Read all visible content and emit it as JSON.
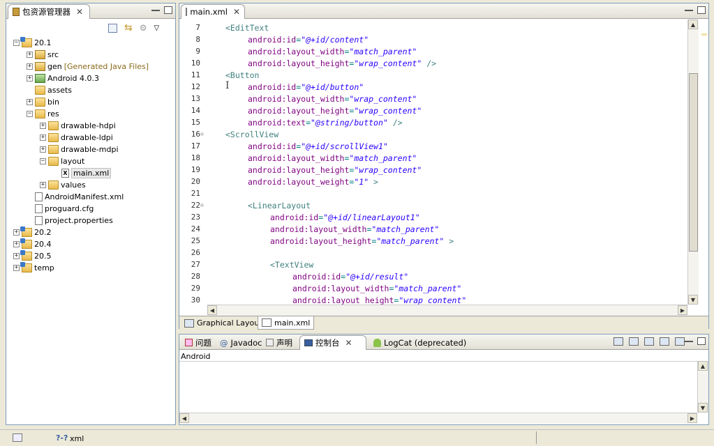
{
  "explorer": {
    "title": "包资源管理器",
    "tree": [
      {
        "label": "20.1",
        "icon": "project-icon",
        "depth": 0,
        "twisty": "−"
      },
      {
        "label": "src",
        "icon": "package-folder-icon",
        "depth": 1,
        "twisty": "+"
      },
      {
        "label": "gen",
        "deco": "[Generated Java Files]",
        "icon": "package-folder-icon",
        "depth": 1,
        "twisty": "+"
      },
      {
        "label": "Android 4.0.3",
        "icon": "library-icon",
        "depth": 1,
        "twisty": "+"
      },
      {
        "label": "assets",
        "icon": "folder-icon",
        "depth": 1,
        "twisty": ""
      },
      {
        "label": "bin",
        "icon": "folder-icon",
        "depth": 1,
        "twisty": "+"
      },
      {
        "label": "res",
        "icon": "folder-icon",
        "depth": 1,
        "twisty": "−"
      },
      {
        "label": "drawable-hdpi",
        "icon": "folder-icon",
        "depth": 2,
        "twisty": "+"
      },
      {
        "label": "drawable-ldpi",
        "icon": "folder-icon",
        "depth": 2,
        "twisty": "+"
      },
      {
        "label": "drawable-mdpi",
        "icon": "folder-icon",
        "depth": 2,
        "twisty": "+"
      },
      {
        "label": "layout",
        "icon": "folder-icon",
        "depth": 2,
        "twisty": "−"
      },
      {
        "label": "main.xml",
        "icon": "xml-file-icon",
        "depth": 3,
        "twisty": "",
        "selected": true
      },
      {
        "label": "values",
        "icon": "folder-icon",
        "depth": 2,
        "twisty": "+"
      },
      {
        "label": "AndroidManifest.xml",
        "icon": "manifest-icon",
        "depth": 1,
        "twisty": ""
      },
      {
        "label": "proguard.cfg",
        "icon": "file-icon",
        "depth": 1,
        "twisty": ""
      },
      {
        "label": "project.properties",
        "icon": "file-icon",
        "depth": 1,
        "twisty": ""
      },
      {
        "label": "20.2",
        "icon": "project-icon",
        "depth": 0,
        "twisty": "+"
      },
      {
        "label": "20.4",
        "icon": "project-icon",
        "depth": 0,
        "twisty": "+"
      },
      {
        "label": "20.5",
        "icon": "project-icon",
        "depth": 0,
        "twisty": "+"
      },
      {
        "label": "temp",
        "icon": "project-icon",
        "depth": 0,
        "twisty": "+"
      }
    ]
  },
  "editor": {
    "tab_label": "main.xml",
    "lines": [
      {
        "n": "7",
        "indent": 1,
        "parts": [
          [
            "tag",
            "<EditText"
          ]
        ]
      },
      {
        "n": "8",
        "indent": 2,
        "parts": [
          [
            "attr",
            "android:id"
          ],
          [
            "punct",
            "="
          ],
          [
            "val",
            "\"@+id/content\""
          ]
        ]
      },
      {
        "n": "9",
        "indent": 2,
        "parts": [
          [
            "attr",
            "android:layout_width"
          ],
          [
            "punct",
            "="
          ],
          [
            "val",
            "\"match_parent\""
          ]
        ]
      },
      {
        "n": "10",
        "indent": 2,
        "parts": [
          [
            "attr",
            "android:layout_height"
          ],
          [
            "punct",
            "="
          ],
          [
            "val",
            "\"wrap_content\""
          ],
          [
            "tag",
            " />"
          ]
        ]
      },
      {
        "n": "11",
        "indent": 1,
        "parts": [
          [
            "tag",
            "<Button"
          ]
        ]
      },
      {
        "n": "12",
        "indent": 2,
        "parts": [
          [
            "attr",
            "android:id"
          ],
          [
            "punct",
            "="
          ],
          [
            "val",
            "\"@+id/button\""
          ]
        ]
      },
      {
        "n": "13",
        "indent": 2,
        "parts": [
          [
            "attr",
            "android:layout_width"
          ],
          [
            "punct",
            "="
          ],
          [
            "val",
            "\"wrap_content\""
          ]
        ]
      },
      {
        "n": "14",
        "indent": 2,
        "parts": [
          [
            "attr",
            "android:layout_height"
          ],
          [
            "punct",
            "="
          ],
          [
            "val",
            "\"wrap_content\""
          ]
        ]
      },
      {
        "n": "15",
        "indent": 2,
        "parts": [
          [
            "attr",
            "android:text"
          ],
          [
            "punct",
            "="
          ],
          [
            "val",
            "\"@string/button\""
          ],
          [
            "tag",
            " />"
          ]
        ]
      },
      {
        "n": "16",
        "indent": 1,
        "fold": true,
        "parts": [
          [
            "tag",
            "<ScrollView"
          ]
        ]
      },
      {
        "n": "17",
        "indent": 2,
        "parts": [
          [
            "attr",
            "android:id"
          ],
          [
            "punct",
            "="
          ],
          [
            "val",
            "\"@+id/scrollView1\""
          ]
        ]
      },
      {
        "n": "18",
        "indent": 2,
        "parts": [
          [
            "attr",
            "android:layout_width"
          ],
          [
            "punct",
            "="
          ],
          [
            "val",
            "\"match_parent\""
          ]
        ]
      },
      {
        "n": "19",
        "indent": 2,
        "parts": [
          [
            "attr",
            "android:layout_height"
          ],
          [
            "punct",
            "="
          ],
          [
            "val",
            "\"wrap_content\""
          ]
        ]
      },
      {
        "n": "20",
        "indent": 2,
        "parts": [
          [
            "attr",
            "android:layout_weight"
          ],
          [
            "punct",
            "="
          ],
          [
            "val",
            "\"1\""
          ],
          [
            "tag",
            " >"
          ]
        ]
      },
      {
        "n": "21",
        "indent": 0,
        "parts": []
      },
      {
        "n": "22",
        "indent": 2,
        "fold": true,
        "parts": [
          [
            "tag",
            "<LinearLayout"
          ]
        ]
      },
      {
        "n": "23",
        "indent": 3,
        "parts": [
          [
            "attr",
            "android:id"
          ],
          [
            "punct",
            "="
          ],
          [
            "val",
            "\"@+id/linearLayout1\""
          ]
        ]
      },
      {
        "n": "24",
        "indent": 3,
        "parts": [
          [
            "attr",
            "android:layout_width"
          ],
          [
            "punct",
            "="
          ],
          [
            "val",
            "\"match_parent\""
          ]
        ]
      },
      {
        "n": "25",
        "indent": 3,
        "parts": [
          [
            "attr",
            "android:layout_height"
          ],
          [
            "punct",
            "="
          ],
          [
            "val",
            "\"match_parent\""
          ],
          [
            "tag",
            " >"
          ]
        ]
      },
      {
        "n": "26",
        "indent": 0,
        "parts": []
      },
      {
        "n": "27",
        "indent": 3,
        "parts": [
          [
            "tag",
            "<TextView"
          ]
        ]
      },
      {
        "n": "28",
        "indent": 4,
        "parts": [
          [
            "attr",
            "android:id"
          ],
          [
            "punct",
            "="
          ],
          [
            "val",
            "\"@+id/result\""
          ]
        ]
      },
      {
        "n": "29",
        "indent": 4,
        "parts": [
          [
            "attr",
            "android:layout_width"
          ],
          [
            "punct",
            "="
          ],
          [
            "val",
            "\"match_parent\""
          ]
        ]
      },
      {
        "n": "30",
        "indent": 4,
        "parts": [
          [
            "attr",
            "android:layout_height"
          ],
          [
            "punct",
            "="
          ],
          [
            "val",
            "\"wrap_content\""
          ]
        ]
      }
    ],
    "bottom_tabs": {
      "graphical": "Graphical Layout",
      "source": "main.xml"
    }
  },
  "console": {
    "tabs": {
      "problems": "问题",
      "javadoc": "Javadoc",
      "declaration": "声明",
      "console": "控制台",
      "logcat": "LogCat (deprecated)"
    },
    "name": "Android"
  },
  "statusbar": {
    "item": "xml",
    "prefix": "?-?"
  }
}
